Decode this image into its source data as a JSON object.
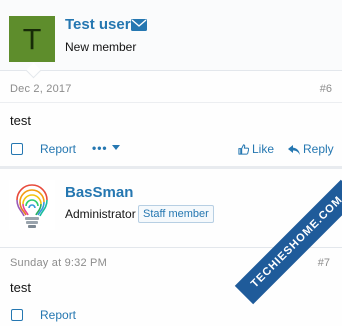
{
  "posts": [
    {
      "avatar_letter": "T",
      "username": "Test user",
      "user_title": "New member",
      "date": "Dec 2, 2017",
      "number": "#6",
      "body": "test",
      "actions": {
        "report": "Report",
        "more": "•••",
        "like": "Like",
        "reply": "Reply"
      }
    },
    {
      "username": "BasSman",
      "user_title": "Administrator",
      "staff_badge": "Staff member",
      "date": "Sunday at 9:32 PM",
      "number": "#7",
      "body": "test",
      "actions": {
        "report": "Report"
      }
    }
  ],
  "watermark": "TECHIESHOME.COM",
  "colors": {
    "link": "#2577b1",
    "avatar_bg": "#5e8d2c",
    "muted": "#8c8c8c"
  }
}
